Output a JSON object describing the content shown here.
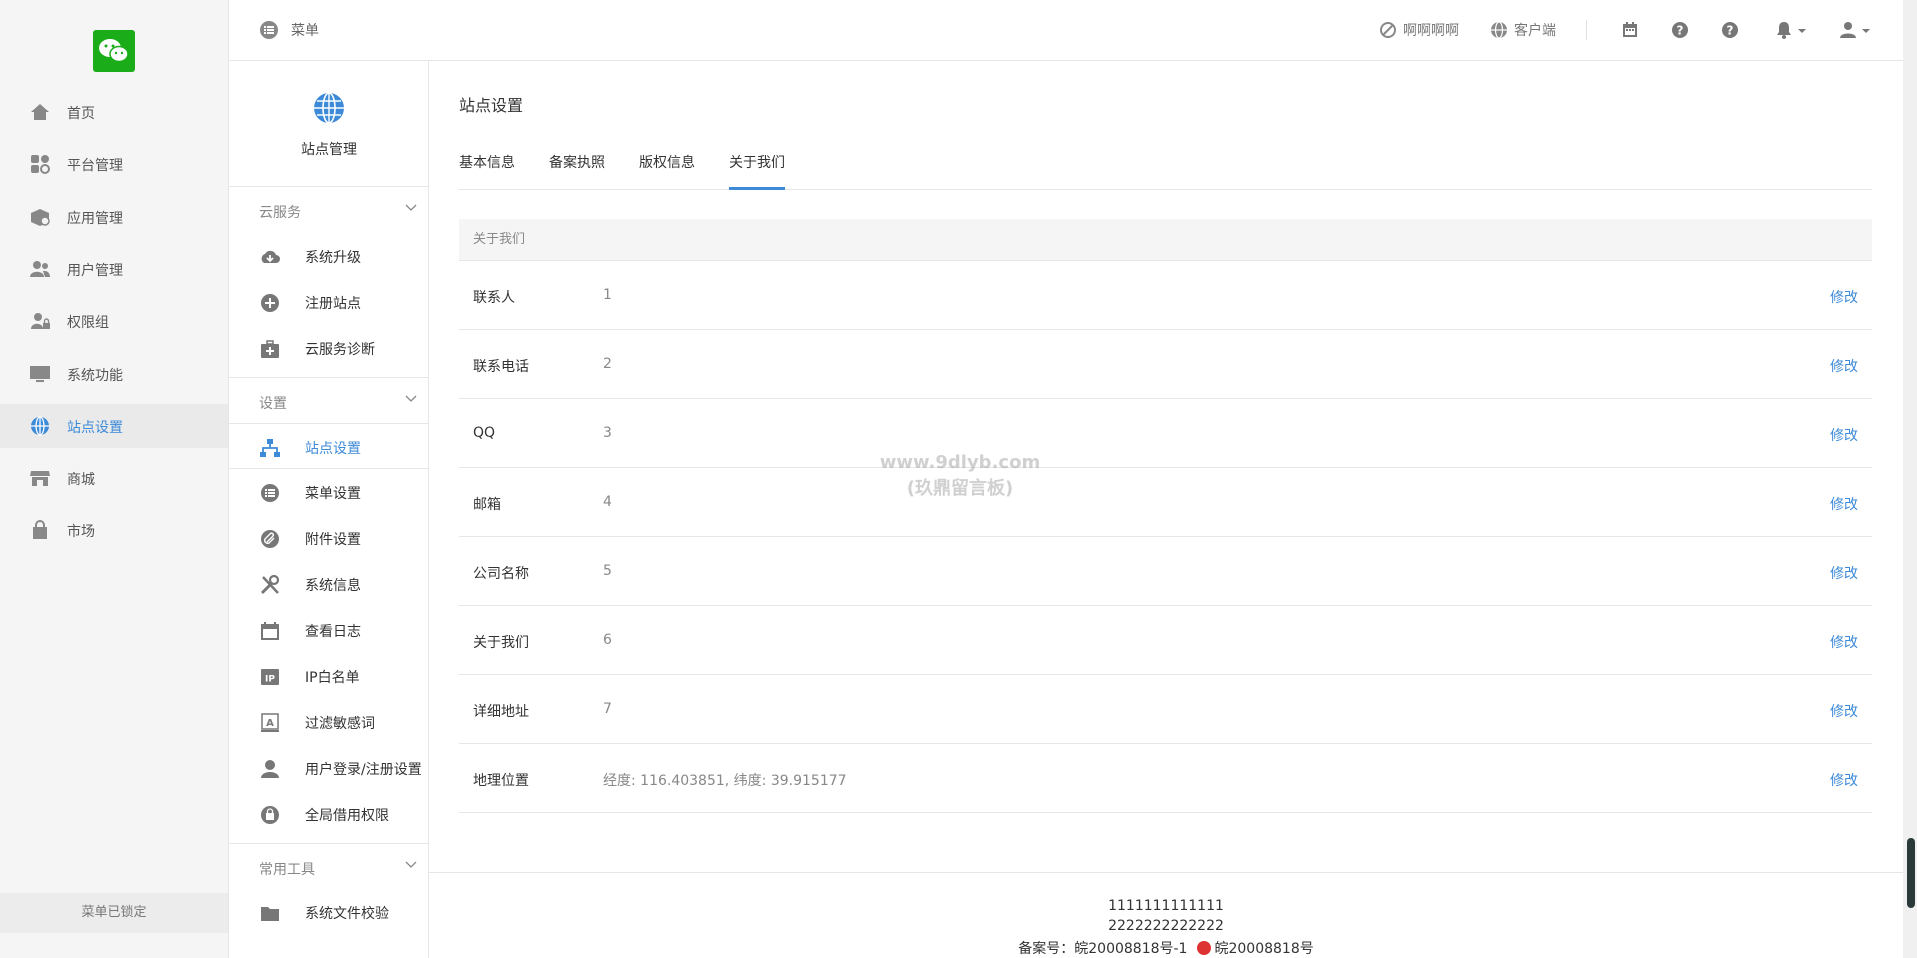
{
  "header": {
    "menu_label": "菜单",
    "links": [
      {
        "label": "啊啊啊啊",
        "icon": "ban-icon"
      },
      {
        "label": "客户端",
        "icon": "globe-icon"
      }
    ],
    "icons": [
      "calendar-icon",
      "help-icon",
      "help-icon",
      "bell-icon",
      "user-icon"
    ]
  },
  "nav": {
    "items": [
      {
        "label": "首页",
        "icon": "home-icon"
      },
      {
        "label": "平台管理",
        "icon": "grid-icon"
      },
      {
        "label": "应用管理",
        "icon": "box-icon"
      },
      {
        "label": "用户管理",
        "icon": "users-icon"
      },
      {
        "label": "权限组",
        "icon": "user-lock-icon"
      },
      {
        "label": "系统功能",
        "icon": "monitor-icon"
      },
      {
        "label": "站点设置",
        "icon": "globe-icon"
      },
      {
        "label": "商城",
        "icon": "store-icon"
      },
      {
        "label": "市场",
        "icon": "bag-icon"
      }
    ],
    "active_index": 6,
    "lock_label": "菜单已锁定"
  },
  "subnav": {
    "title": "站点管理",
    "groups": [
      {
        "label": "云服务",
        "items": [
          {
            "label": "系统升级",
            "icon": "cloud-download-icon"
          },
          {
            "label": "注册站点",
            "icon": "plus-circle-icon"
          },
          {
            "label": "云服务诊断",
            "icon": "medkit-icon"
          }
        ]
      },
      {
        "label": "设置",
        "items": [
          {
            "label": "站点设置",
            "icon": "sitemap-icon"
          },
          {
            "label": "菜单设置",
            "icon": "list-icon"
          },
          {
            "label": "附件设置",
            "icon": "paperclip-icon"
          },
          {
            "label": "系统信息",
            "icon": "tools-icon"
          },
          {
            "label": "查看日志",
            "icon": "calendar-icon"
          },
          {
            "label": "IP白名单",
            "icon": "ip-icon"
          },
          {
            "label": "过滤敏感词",
            "icon": "filter-text-icon"
          },
          {
            "label": "用户登录/注册设置",
            "icon": "user-icon"
          },
          {
            "label": "全局借用权限",
            "icon": "lock-clock-icon"
          }
        ]
      },
      {
        "label": "常用工具",
        "items": [
          {
            "label": "系统文件校验",
            "icon": "folder-icon"
          }
        ]
      }
    ]
  },
  "main": {
    "title": "站点设置",
    "tabs": [
      "基本信息",
      "备案执照",
      "版权信息",
      "关于我们"
    ],
    "active_tab": 3,
    "section_header": "关于我们",
    "rows": [
      {
        "key": "联系人",
        "value": "1",
        "action": "修改"
      },
      {
        "key": "联系电话",
        "value": "2",
        "action": "修改"
      },
      {
        "key": "QQ",
        "value": "3",
        "action": "修改"
      },
      {
        "key": "邮箱",
        "value": "4",
        "action": "修改"
      },
      {
        "key": "公司名称",
        "value": "5",
        "action": "修改"
      },
      {
        "key": "关于我们",
        "value": "6",
        "action": "修改"
      },
      {
        "key": "详细地址",
        "value": "7",
        "action": "修改"
      },
      {
        "key": "地理位置",
        "value": "经度: 116.403851, 纬度: 39.915177",
        "action": "修改"
      }
    ]
  },
  "footer": {
    "line1": "1111111111111",
    "line2": "2222222222222",
    "icp": "备案号：皖20008818号-1",
    "police": "皖20008818号"
  },
  "watermark": {
    "line1": "www.9dlyb.com",
    "line2": "(玖鼎留言板)"
  },
  "colors": {
    "accent": "#3d8ad8",
    "logo": "#1aad19"
  }
}
